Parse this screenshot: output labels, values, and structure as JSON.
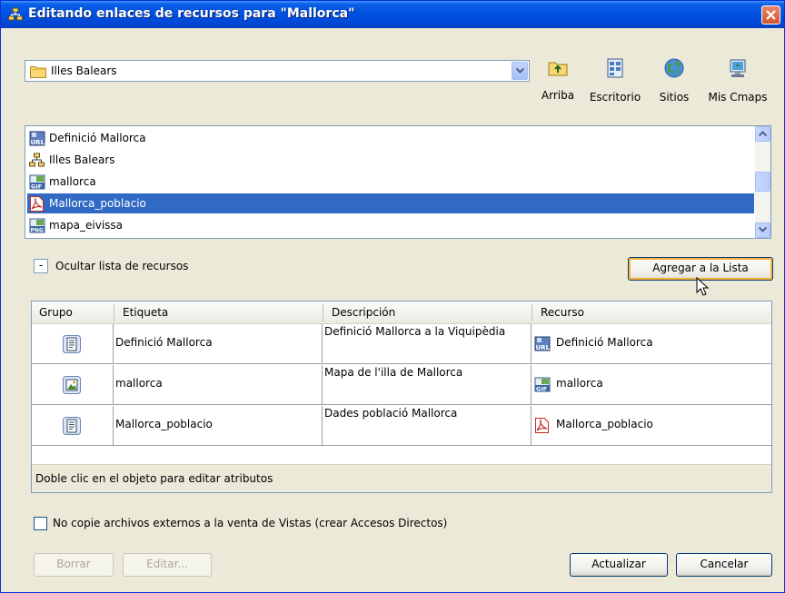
{
  "window": {
    "title": "Editando enlaces de recursos para \"Mallorca\""
  },
  "folder": {
    "value": "Illes Balears"
  },
  "nav": [
    {
      "label": "Arriba",
      "icon": "up-folder-icon"
    },
    {
      "label": "Escritorio",
      "icon": "desktop-icon"
    },
    {
      "label": "Sitios",
      "icon": "globe-icon"
    },
    {
      "label": "Mis Cmaps",
      "icon": "my-cmaps-icon"
    }
  ],
  "resources": [
    {
      "label": "Definició Mallorca",
      "icon": "url-icon"
    },
    {
      "label": "Illes Balears",
      "icon": "cmap-icon"
    },
    {
      "label": "mallorca",
      "icon": "gif-icon"
    },
    {
      "label": "Mallorca_poblacio",
      "icon": "pdf-icon",
      "selected": true
    },
    {
      "label": "mapa_eivissa",
      "icon": "png-icon"
    }
  ],
  "toggle": {
    "symbol": "-",
    "label": "Ocultar lista de recursos"
  },
  "add_button": "Agregar a la Lista",
  "table": {
    "headers": [
      "Grupo",
      "Etiqueta",
      "Descripción",
      "Recurso"
    ],
    "rows": [
      {
        "group_icon": "document-group-icon",
        "label": "Definició Mallorca",
        "description": "Definició Mallorca a la Viquipèdia",
        "resource": "Definició Mallorca",
        "resource_icon": "url-icon"
      },
      {
        "group_icon": "image-group-icon",
        "label": "mallorca",
        "description": "Mapa de l'illa de Mallorca",
        "resource": "mallorca",
        "resource_icon": "gif-icon"
      },
      {
        "group_icon": "document-group-icon",
        "label": "Mallorca_poblacio",
        "description": "Dades població Mallorca",
        "resource": "Mallorca_poblacio",
        "resource_icon": "pdf-icon"
      }
    ],
    "status": "Doble clic en el objeto para editar atributos"
  },
  "checkbox": {
    "label": "No copie archivos externos a la venta de Vistas (crear Accesos Directos)",
    "checked": false
  },
  "buttons": {
    "delete": "Borrar",
    "edit": "Editar...",
    "update": "Actualizar",
    "cancel": "Cancelar"
  },
  "colors": {
    "selection": "#316ac5",
    "titlebar": "#0050e0",
    "dialog": "#ece9d8"
  }
}
